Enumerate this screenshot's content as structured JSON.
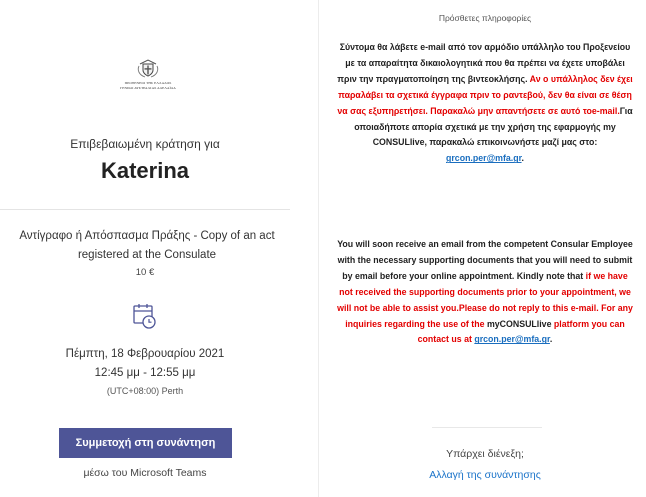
{
  "emblem": {
    "icon": "greek-coat-of-arms-icon",
    "caption_line1": "ΠΡΟΞΕΝΕΙΟ ΤΗΣ ΕΛΛΑΔΟΣ",
    "caption_line2": "ΓΕΝΙΚΟ ΑΥΣΤΡΑΛΙΑΣ ΑΔΕΛΑΪΔΑ"
  },
  "booking": {
    "confirmed_label": "Επιβεβαιωμένη κράτηση για",
    "name": "Katerina",
    "service": "Αντίγραφο ή Απόσπασμα Πράξης - Copy of an act registered at the Consulate",
    "price": "10 €",
    "calendar_icon": "calendar-clock-icon",
    "date": "Πέμπτη, 18 Φεβρουαρίου 2021",
    "time": "12:45 μμ - 12:55 μμ",
    "timezone": "(UTC+08:00) Perth",
    "join_label": "Συμμετοχή στη συνάντηση",
    "via_label": "μέσω του Microsoft Teams"
  },
  "info": {
    "title": "Πρόσθετες πληροφορίες",
    "greek": {
      "intro": "Σύντομα θα λάβετε e-mail από τον αρμόδιο υπάλληλο του Προξενείου με τα απαραίτητα δικαιολογητικά που θα πρέπει να έχετε υποβάλει πριν την πραγματοποίηση της βιντεοκλήσης. ",
      "warning": "Αν ο υπάλληλος δεν έχει παραλάβει τα σχετικά έγγραφα πριν το ραντεβού, δεν θα είναι σε θέση να σας εξυπηρετήσει. Παρακαλώ μην απαντήσετε σε αυτό τοe-mail.",
      "outro": "Για οποιαδήποτε απορία σχετικά με την χρήση της εφαρμογής my CONSULlive, παρακαλώ επικοινωνήστε μαζί μας στο: ",
      "email": "grcon.per@mfa.gr",
      "end": "."
    },
    "english": {
      "intro": "You will soon receive an email from the competent Consular Employee with the necessary supporting documents that you will need to submit by email before your online appointment. Kindly note that ",
      "warning": "if we have not received the supporting documents prior to your appointment, we will not be able to assist you.Please do not reply to this e-mail. For any inquiries regarding the use of the ",
      "product": "myCONSULlive",
      "outro": " platform you can contact us at ",
      "email": "grcon.per@mfa.gr",
      "end": "."
    }
  },
  "footer": {
    "change_label": "Υπάρχει διένεξη;",
    "reschedule_label": "Αλλαγή της συνάντησης"
  }
}
